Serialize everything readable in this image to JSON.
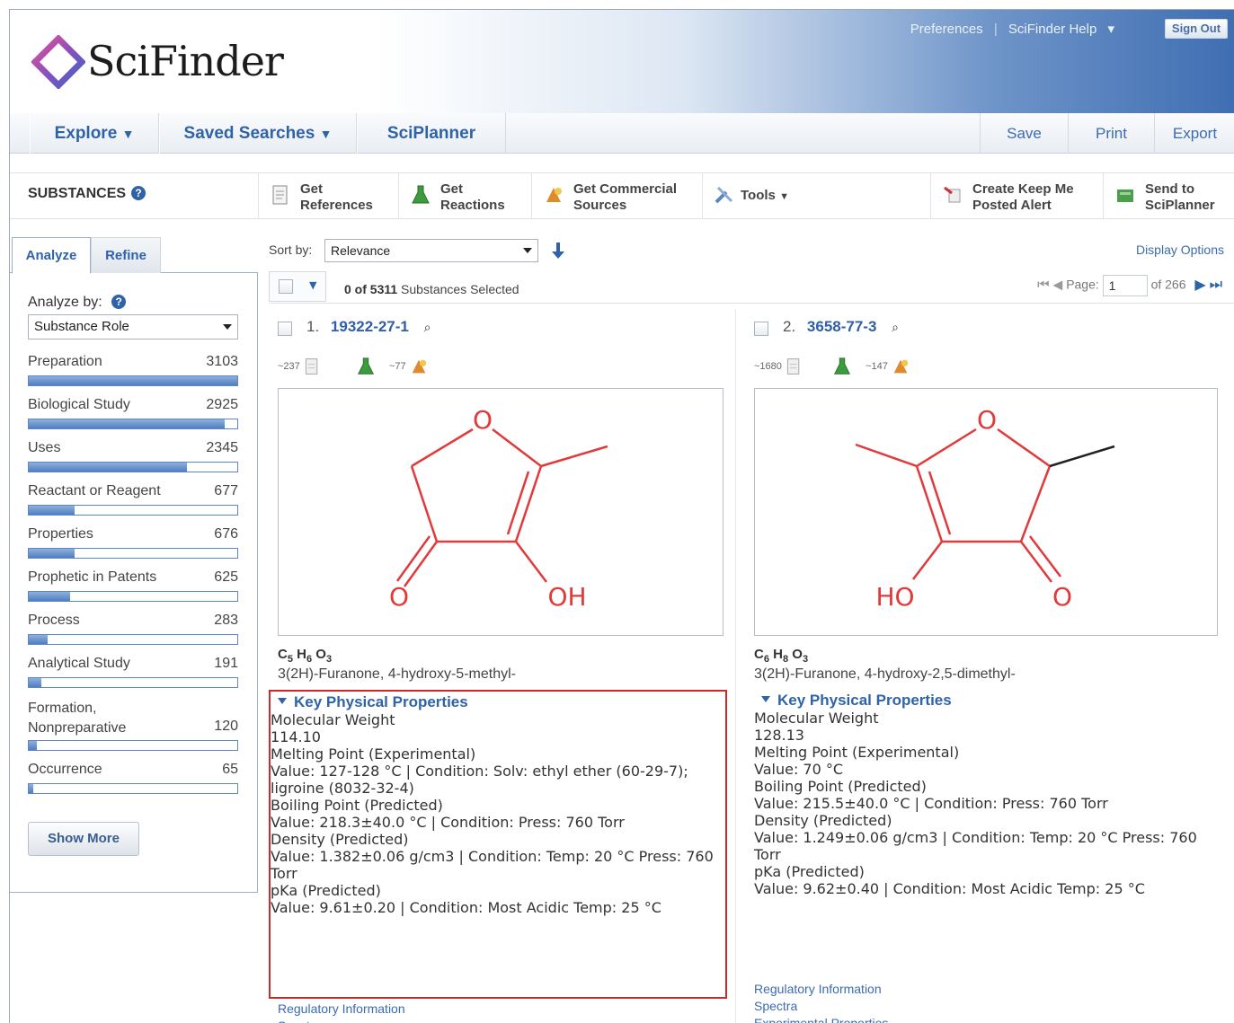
{
  "app": {
    "brand": "SciFinder",
    "top_links": {
      "preferences": "Preferences",
      "separator": "|",
      "help": "SciFinder Help",
      "sign_out": "Sign Out"
    }
  },
  "nav": {
    "explore": "Explore",
    "saved_searches": "Saved Searches",
    "sciplanner": "SciPlanner",
    "save": "Save",
    "print": "Print",
    "export": "Export"
  },
  "toolbar": {
    "section_title": "SUBSTANCES",
    "get_references": [
      "Get",
      "References"
    ],
    "get_reactions": [
      "Get",
      "Reactions"
    ],
    "get_commercial": [
      "Get Commercial",
      "Sources"
    ],
    "tools": "Tools",
    "create_alert": [
      "Create Keep Me",
      "Posted Alert"
    ],
    "send_to": [
      "Send to",
      "SciPlanner"
    ]
  },
  "left": {
    "tabs": {
      "analyze": "Analyze",
      "refine": "Refine"
    },
    "analyze_by_label": "Analyze by:",
    "analyze_by_value": "Substance Role",
    "roles": [
      {
        "label": "Preparation",
        "count": "3103",
        "fill": 1.0
      },
      {
        "label": "Biological Study",
        "count": "2925",
        "fill": 0.94
      },
      {
        "label": "Uses",
        "count": "2345",
        "fill": 0.76
      },
      {
        "label": "Reactant or Reagent",
        "count": "677",
        "fill": 0.22
      },
      {
        "label": "Properties",
        "count": "676",
        "fill": 0.22
      },
      {
        "label": "Prophetic in Patents",
        "count": "625",
        "fill": 0.2
      },
      {
        "label": "Process",
        "count": "283",
        "fill": 0.09
      },
      {
        "label": "Analytical Study",
        "count": "191",
        "fill": 0.06
      },
      {
        "label": [
          "Formation,",
          "Nonpreparative"
        ],
        "count": "120",
        "fill": 0.04
      },
      {
        "label": "Occurrence",
        "count": "65",
        "fill": 0.02
      }
    ],
    "show_more": "Show More"
  },
  "main": {
    "sort_label": "Sort by:",
    "sort_value": "Relevance",
    "display_options": "Display Options",
    "selected_count": "0 of 5311",
    "selected_suffix": "Substances Selected",
    "page_label": "Page:",
    "page_value": "1",
    "page_total": "of 266",
    "results": [
      {
        "index": "1.",
        "cas": "19322-27-1",
        "refs": "~237",
        "sources": "~77",
        "formula": {
          "c": "5",
          "h": "6",
          "o": "3"
        },
        "name": "3(2H)-Furanone, 4-hydroxy-5-methyl-",
        "atom_labels": [
          "O",
          "O",
          "OH"
        ],
        "kpp_title": "Key Physical Properties",
        "props": [
          {
            "label": "Molecular Weight",
            "value": "114.10"
          },
          {
            "label": "Melting Point (Experimental)",
            "value": "Value: 127-128 °C | Condition: Solv: ethyl ether (60-29-7); ligroine (8032-32-4)"
          },
          {
            "label": "Boiling Point (Predicted)",
            "value": "Value: 218.3±40.0 °C | Condition: Press: 760 Torr"
          },
          {
            "label": "Density (Predicted)",
            "value": "Value: 1.382±0.06 g/cm3 | Condition: Temp: 20 °C Press: 760 Torr"
          },
          {
            "label": "pKa (Predicted)",
            "value": "Value: 9.61±0.20 | Condition: Most Acidic Temp: 25 °C"
          }
        ],
        "links": [
          "Regulatory Information",
          "Spectra"
        ]
      },
      {
        "index": "2.",
        "cas": "3658-77-3",
        "refs": "~1680",
        "sources": "~147",
        "formula": {
          "c": "6",
          "h": "8",
          "o": "3"
        },
        "name": "3(2H)-Furanone, 4-hydroxy-2,5-dimethyl-",
        "atom_labels": [
          "O",
          "HO",
          "O"
        ],
        "kpp_title": "Key Physical Properties",
        "props": [
          {
            "label": "Molecular Weight",
            "value": "128.13"
          },
          {
            "label": "Melting Point (Experimental)",
            "value": "Value: 70 °C"
          },
          {
            "label": "Boiling Point (Predicted)",
            "value": "Value: 215.5±40.0 °C | Condition: Press: 760 Torr"
          },
          {
            "label": "Density (Predicted)",
            "value": "Value: 1.249±0.06 g/cm3 | Condition: Temp: 20 °C Press: 760 Torr"
          },
          {
            "label": "pKa (Predicted)",
            "value": "Value: 9.62±0.40 | Condition: Most Acidic Temp: 25 °C"
          }
        ],
        "links": [
          "Regulatory Information",
          "Spectra",
          "Experimental Properties"
        ]
      }
    ]
  },
  "colors": {
    "link": "#2f63a8",
    "highlight_box": "#cc2b2b",
    "structure": "#e03a3a"
  }
}
